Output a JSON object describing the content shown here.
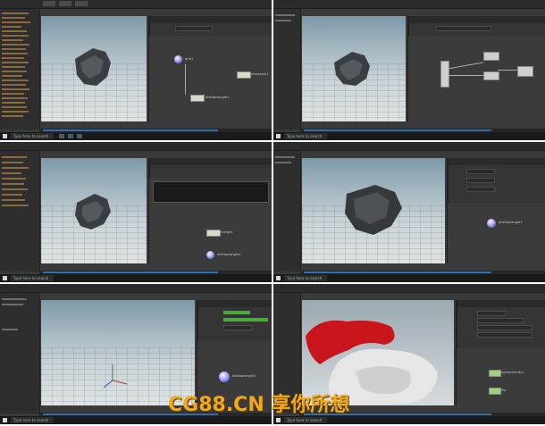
{
  "taskbar": {
    "search_placeholder": "Type here to search"
  },
  "panels": [
    {
      "id": "p1",
      "node_labels": [
        "grid1",
        "mountain1",
        "attribwrangle1"
      ]
    },
    {
      "id": "p2",
      "node_labels": []
    },
    {
      "id": "p3",
      "node_labels": [
        "merge1",
        "attribwrangle1"
      ]
    },
    {
      "id": "p4",
      "node_labels": [
        "attribwrangle1"
      ]
    },
    {
      "id": "p5",
      "node_labels": [
        "attribwrangle1"
      ]
    },
    {
      "id": "p6",
      "node_labels": [
        "pointvelocity1",
        "flip"
      ]
    }
  ],
  "watermark": {
    "text": "CG88.CN 享你所想"
  },
  "colors": {
    "accent_blue": "#2f6fae",
    "watermark_orange": "#f2a81b",
    "sim_red": "#c8141a"
  }
}
